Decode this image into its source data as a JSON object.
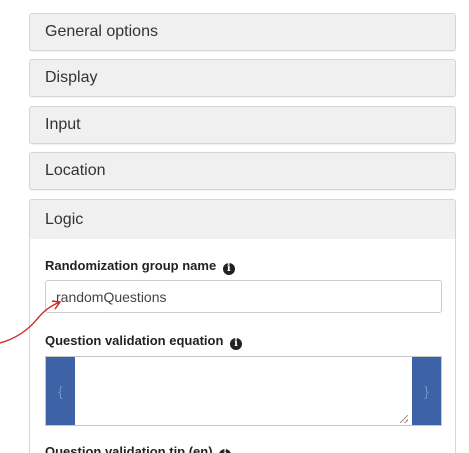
{
  "panels": {
    "general": "General options",
    "display": "Display",
    "input": "Input",
    "location": "Location",
    "logic": "Logic"
  },
  "logic": {
    "randomization_label": "Randomization group name",
    "randomization_value": "randomQuestions",
    "validation_label": "Question validation equation",
    "validation_value": "",
    "validation_open_brace": "{",
    "validation_close_brace": "}",
    "tip_label": "Question validation tip (en)"
  },
  "icons": {
    "info": "info-circle-icon",
    "annotation": "red-arrow-annotation"
  },
  "colors": {
    "panel_bg": "#f0f0f0",
    "brace_bg": "#3e62a6",
    "annotation": "#d62020"
  }
}
